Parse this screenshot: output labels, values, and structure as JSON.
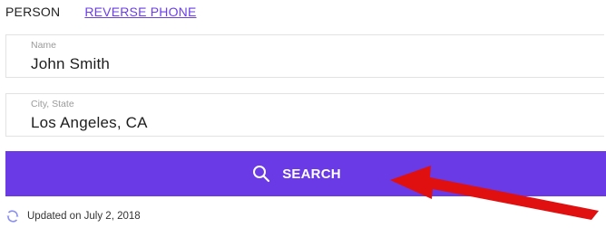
{
  "tabs": {
    "person": "PERSON",
    "reverse_phone": "REVERSE PHONE"
  },
  "name_field": {
    "label": "Name",
    "value": "John Smith"
  },
  "location_field": {
    "label": "City, State",
    "value": "Los Angeles, CA"
  },
  "search_button": {
    "label": "SEARCH",
    "icon": "search-icon"
  },
  "footer": {
    "updated_text": "Updated on July 2, 2018",
    "icon": "refresh-icon"
  },
  "colors": {
    "accent": "#6a3ae6",
    "link": "#6b3fe8",
    "annotation_arrow": "#e01010"
  }
}
